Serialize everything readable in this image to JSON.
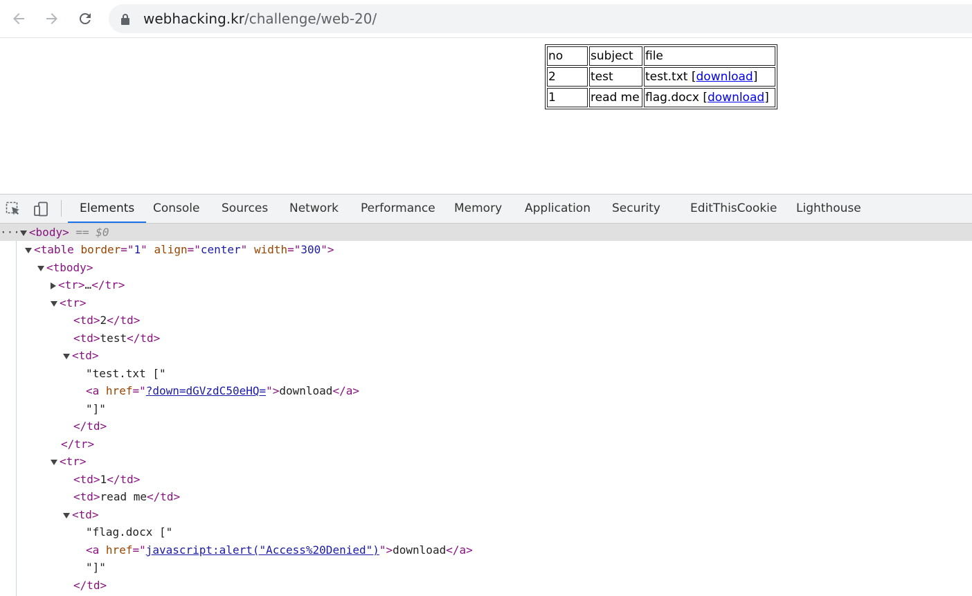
{
  "browser": {
    "url_host": "webhacking.kr",
    "url_path": "/challenge/web-20/"
  },
  "page_table": {
    "header": {
      "no": "no",
      "subject": "subject",
      "file": "file"
    },
    "rows": [
      {
        "no": "2",
        "subject": "test",
        "file": "test.txt",
        "link_label": "download"
      },
      {
        "no": "1",
        "subject": "read me",
        "file": "flag.docx",
        "link_label": "download"
      }
    ]
  },
  "devtools": {
    "tabs": [
      "Elements",
      "Console",
      "Sources",
      "Network",
      "Performance",
      "Memory",
      "Application",
      "Security",
      "EditThisCookie",
      "Lighthouse"
    ],
    "active_tab": "Elements",
    "dom": {
      "body_tag": "body",
      "selected_marker": "== $0",
      "table_tag": "table",
      "table_attrs": [
        {
          "name": "border",
          "value": "1"
        },
        {
          "name": "align",
          "value": "center"
        },
        {
          "name": "width",
          "value": "300"
        }
      ],
      "tbody_tag": "tbody",
      "tr_tag": "tr",
      "td_tag": "td",
      "a_tag": "a",
      "href_attr": "href",
      "ellipsis": "…",
      "row1": {
        "td_no": "2",
        "td_subject": "test",
        "text_before": "\"test.txt [\"",
        "href": "?down=dGVzdC50eHQ=",
        "link_text": "download",
        "text_after": "\"]\""
      },
      "row2": {
        "td_no": "1",
        "td_subject": "read me",
        "text_before": "\"flag.docx [\"",
        "href": "javascript:alert(\"Access%20Denied\")",
        "link_text": "download",
        "text_after": "\"]\""
      }
    }
  }
}
